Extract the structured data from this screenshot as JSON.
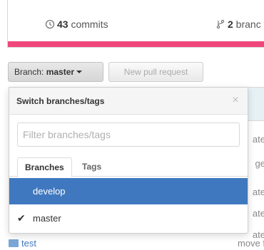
{
  "stats": {
    "commits_count": "43",
    "commits_label": " commits",
    "branches_count": "2",
    "branches_label": " branc"
  },
  "toolbar": {
    "branch_prefix": "Branch: ",
    "branch_name": "master",
    "new_pr_label": "New pull request"
  },
  "background_list": {
    "row_fragments": [
      "ate",
      "ge",
      "ate",
      "ate",
      "ate"
    ],
    "test_folder_name": "test",
    "test_folder_message": "move f"
  },
  "dropdown": {
    "title": "Switch branches/tags",
    "filter_placeholder": "Filter branches/tags",
    "tabs": [
      "Branches",
      "Tags"
    ],
    "items": [
      "develop",
      "master"
    ],
    "selected_item": "master",
    "highlighted_item": "develop"
  },
  "colors": {
    "language_bar": "#f0467c",
    "highlight": "#4078c0"
  }
}
